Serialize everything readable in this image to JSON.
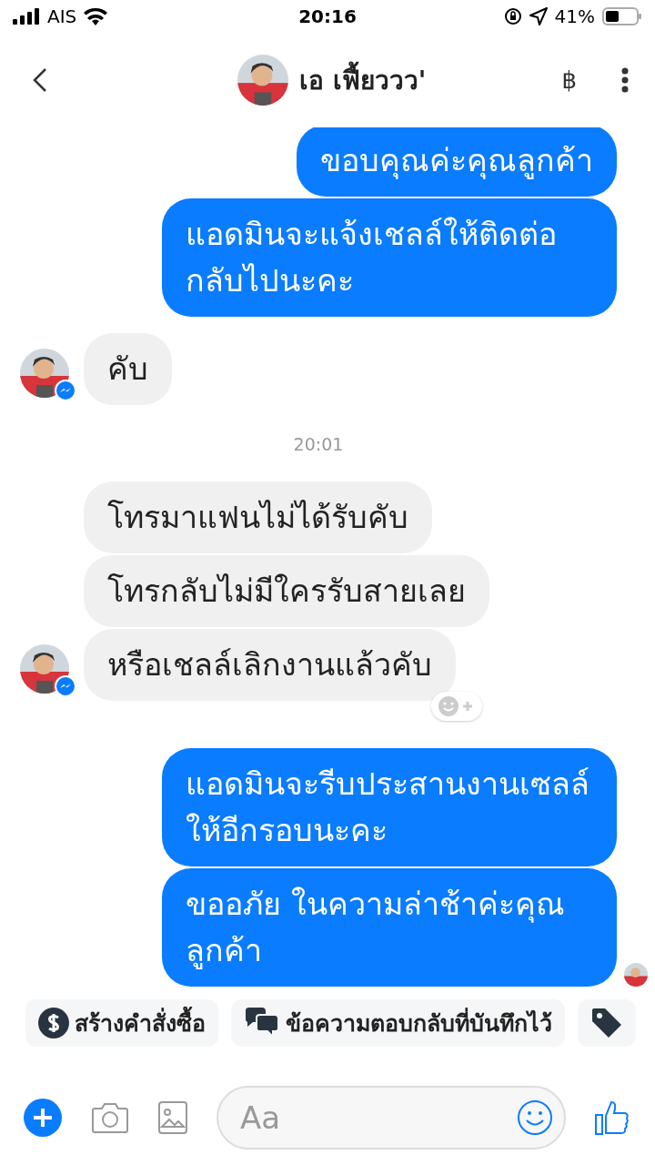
{
  "status_bar": {
    "carrier": "AIS",
    "time": "20:16",
    "battery": "41%"
  },
  "header": {
    "name": "เอ เฟี้ยววว'",
    "currency": "฿"
  },
  "messages": [
    {
      "kind": "outgoing",
      "text": "ขอบคุณค่ะคุณลูกค้า"
    },
    {
      "kind": "outgoing",
      "text": "แอดมินจะแจ้งเชลล์ให้ติดต่อกลับไปนะคะ"
    },
    {
      "kind": "incoming",
      "text": "คับ",
      "avatar": true
    },
    {
      "kind": "timestamp",
      "text": "20:01"
    },
    {
      "kind": "incoming",
      "text": "โทรมาแฟนไม่ได้รับคับ",
      "avatar": false
    },
    {
      "kind": "incoming",
      "text": "โทรกลับไม่มีใครรับสายเลย",
      "avatar": false
    },
    {
      "kind": "incoming",
      "text": "หรือเชลล์เลิกงานแล้วคับ",
      "avatar": true,
      "reaction_button": true
    },
    {
      "kind": "outgoing",
      "text": "แอดมินจะรีบประสานงานเซลล์ให้อีกรอบนะคะ"
    },
    {
      "kind": "outgoing",
      "text": "ขออภัย ในความล่าช้าค่ะคุณลูกค้า",
      "seen": true
    }
  ],
  "quick_replies": [
    {
      "kind": "order",
      "label": "สร้างคำสั่งซื้อ"
    },
    {
      "kind": "saved",
      "label": "ข้อความตอบกลับที่บันทึกไว้"
    },
    {
      "kind": "tag"
    }
  ],
  "composer": {
    "placeholder": "Aa"
  }
}
